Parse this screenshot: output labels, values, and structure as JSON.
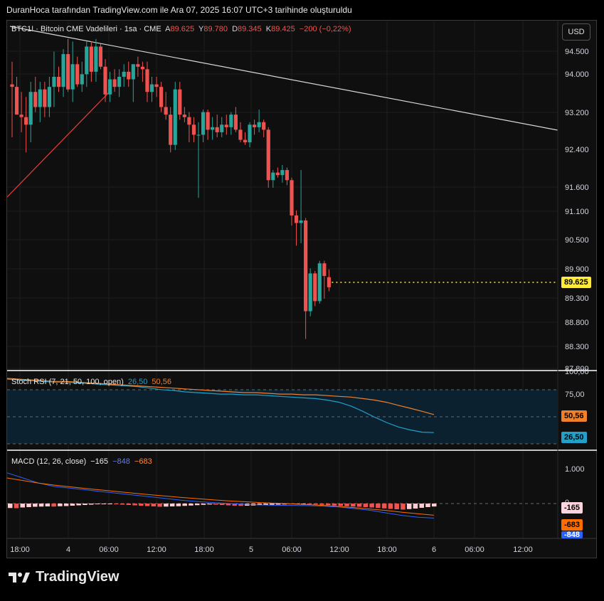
{
  "header": {
    "caption": "DuranHoca tarafından TradingView.com ile Ara 07, 2025 16:07 UTC+3 tarihinde oluşturuldu"
  },
  "currency_button": "USD",
  "legend": {
    "symbol": "BTC1! · Bitcoin CME Vadelileri · 1sa · CME",
    "o_label": "A",
    "o_value": "89.625",
    "h_label": "Y",
    "h_value": "89.780",
    "l_label": "D",
    "l_value": "89.345",
    "c_label": "K",
    "c_value": "89.425",
    "change": "−200 (−0,22%)"
  },
  "last_price_tag": "89.625",
  "stoch": {
    "title": "Stoch RSI (7, 21, 50, 100, open)",
    "k": "26,50",
    "d": "50,56",
    "tag_d": "50,56",
    "tag_k": "26,50"
  },
  "macd": {
    "title": "MACD (12, 26, close)",
    "hist": "−165",
    "macd": "−848",
    "signal": "−683",
    "tag_hist": "-165",
    "tag_signal": "-683",
    "tag_macd": "-848"
  },
  "brand": {
    "name": "TradingView"
  },
  "colors": {
    "up": "#26a69a",
    "down": "#ef5350",
    "stoch_k": "#22a0c8",
    "stoch_d": "#f0802a",
    "macd": "#2962ff",
    "signal": "#ff6d00",
    "last_price": "#ffeb3b"
  },
  "chart_data": [
    {
      "type": "candlestick",
      "title": "BTC1! · Bitcoin CME Vadelileri · 1sa · CME",
      "price_axis_ticks": [
        "94.500",
        "94.000",
        "93.200",
        "92.400",
        "91.600",
        "91.100",
        "90.500",
        "89.900",
        "89.300",
        "88.800",
        "88.300",
        "87.800"
      ],
      "time_axis_ticks": [
        "18:00",
        "4",
        "06:00",
        "12:00",
        "18:00",
        "5",
        "06:00",
        "12:00",
        "18:00",
        "6",
        "06:00",
        "12:00"
      ],
      "candles": [
        {
          "o": 93.45,
          "h": 93.9,
          "l": 92.4,
          "c": 93.4
        },
        {
          "o": 93.4,
          "h": 93.6,
          "l": 92.9,
          "c": 92.85
        },
        {
          "o": 92.85,
          "h": 93.3,
          "l": 92.5,
          "c": 92.8
        },
        {
          "o": 92.8,
          "h": 93.2,
          "l": 92.1,
          "c": 92.65
        },
        {
          "o": 92.65,
          "h": 93.5,
          "l": 92.3,
          "c": 93.3
        },
        {
          "o": 93.3,
          "h": 93.6,
          "l": 92.9,
          "c": 93.0
        },
        {
          "o": 93.0,
          "h": 93.5,
          "l": 92.7,
          "c": 93.35
        },
        {
          "o": 93.35,
          "h": 93.5,
          "l": 92.8,
          "c": 93.0
        },
        {
          "o": 93.0,
          "h": 93.6,
          "l": 92.8,
          "c": 93.4
        },
        {
          "o": 93.4,
          "h": 94.1,
          "l": 93.0,
          "c": 93.6
        },
        {
          "o": 93.6,
          "h": 93.8,
          "l": 93.3,
          "c": 93.4
        },
        {
          "o": 93.4,
          "h": 94.15,
          "l": 93.2,
          "c": 94.05
        },
        {
          "o": 94.05,
          "h": 94.35,
          "l": 93.3,
          "c": 93.35
        },
        {
          "o": 93.35,
          "h": 94.3,
          "l": 93.1,
          "c": 93.85
        },
        {
          "o": 93.85,
          "h": 94.0,
          "l": 93.4,
          "c": 93.45
        },
        {
          "o": 93.45,
          "h": 93.9,
          "l": 93.3,
          "c": 93.65
        },
        {
          "o": 93.65,
          "h": 94.3,
          "l": 93.4,
          "c": 94.2
        },
        {
          "o": 94.2,
          "h": 94.3,
          "l": 93.5,
          "c": 93.7
        },
        {
          "o": 93.7,
          "h": 94.35,
          "l": 93.5,
          "c": 94.2
        },
        {
          "o": 94.2,
          "h": 94.25,
          "l": 93.75,
          "c": 93.8
        },
        {
          "o": 93.8,
          "h": 93.95,
          "l": 93.1,
          "c": 93.25
        },
        {
          "o": 93.25,
          "h": 93.7,
          "l": 93.1,
          "c": 93.55
        },
        {
          "o": 93.55,
          "h": 93.75,
          "l": 93.3,
          "c": 93.4
        },
        {
          "o": 93.4,
          "h": 93.75,
          "l": 93.2,
          "c": 93.6
        },
        {
          "o": 93.6,
          "h": 93.85,
          "l": 93.4,
          "c": 93.7
        },
        {
          "o": 93.7,
          "h": 93.9,
          "l": 93.4,
          "c": 93.55
        },
        {
          "o": 93.55,
          "h": 93.8,
          "l": 93.1,
          "c": 93.85
        },
        {
          "o": 93.85,
          "h": 94.0,
          "l": 93.6,
          "c": 93.8
        },
        {
          "o": 93.8,
          "h": 93.9,
          "l": 93.5,
          "c": 93.75
        },
        {
          "o": 93.75,
          "h": 93.9,
          "l": 93.1,
          "c": 93.3
        },
        {
          "o": 93.3,
          "h": 93.6,
          "l": 93.1,
          "c": 93.45
        },
        {
          "o": 93.45,
          "h": 93.6,
          "l": 93.2,
          "c": 93.4
        },
        {
          "o": 93.4,
          "h": 93.5,
          "l": 92.9,
          "c": 93.0
        },
        {
          "o": 93.0,
          "h": 93.3,
          "l": 92.75,
          "c": 92.85
        },
        {
          "o": 92.85,
          "h": 93.0,
          "l": 92.1,
          "c": 92.25
        },
        {
          "o": 92.25,
          "h": 93.5,
          "l": 92.15,
          "c": 93.35
        },
        {
          "o": 93.35,
          "h": 93.5,
          "l": 92.75,
          "c": 92.85
        },
        {
          "o": 92.85,
          "h": 93.0,
          "l": 92.7,
          "c": 92.8
        },
        {
          "o": 92.8,
          "h": 92.9,
          "l": 92.3,
          "c": 92.65
        },
        {
          "o": 92.65,
          "h": 92.8,
          "l": 92.3,
          "c": 92.45
        },
        {
          "o": 92.45,
          "h": 92.7,
          "l": 91.2,
          "c": 92.45
        },
        {
          "o": 92.45,
          "h": 92.95,
          "l": 92.3,
          "c": 92.9
        },
        {
          "o": 92.9,
          "h": 92.95,
          "l": 92.35,
          "c": 92.55
        },
        {
          "o": 92.55,
          "h": 92.8,
          "l": 92.35,
          "c": 92.6
        },
        {
          "o": 92.6,
          "h": 92.85,
          "l": 92.4,
          "c": 92.5
        },
        {
          "o": 92.5,
          "h": 92.8,
          "l": 92.4,
          "c": 92.65
        },
        {
          "o": 92.65,
          "h": 92.85,
          "l": 92.45,
          "c": 92.6
        },
        {
          "o": 92.6,
          "h": 92.9,
          "l": 92.45,
          "c": 92.85
        },
        {
          "o": 92.85,
          "h": 93.0,
          "l": 92.5,
          "c": 92.55
        },
        {
          "o": 92.55,
          "h": 92.7,
          "l": 92.3,
          "c": 92.35
        },
        {
          "o": 92.35,
          "h": 92.5,
          "l": 92.25,
          "c": 92.3
        },
        {
          "o": 92.3,
          "h": 92.7,
          "l": 92.2,
          "c": 92.65
        },
        {
          "o": 92.65,
          "h": 92.75,
          "l": 92.45,
          "c": 92.6
        },
        {
          "o": 92.6,
          "h": 92.95,
          "l": 92.5,
          "c": 92.7
        },
        {
          "o": 92.7,
          "h": 92.75,
          "l": 92.4,
          "c": 92.55
        },
        {
          "o": 92.55,
          "h": 92.6,
          "l": 91.4,
          "c": 91.55
        },
        {
          "o": 91.55,
          "h": 91.75,
          "l": 91.4,
          "c": 91.7
        },
        {
          "o": 91.7,
          "h": 91.8,
          "l": 91.6,
          "c": 91.65
        },
        {
          "o": 91.65,
          "h": 91.85,
          "l": 91.5,
          "c": 91.75
        },
        {
          "o": 91.75,
          "h": 91.8,
          "l": 91.45,
          "c": 91.55
        },
        {
          "o": 91.55,
          "h": 91.6,
          "l": 90.65,
          "c": 90.85
        },
        {
          "o": 90.85,
          "h": 90.95,
          "l": 90.25,
          "c": 90.7
        },
        {
          "o": 90.7,
          "h": 91.75,
          "l": 90.3,
          "c": 90.75
        },
        {
          "o": 90.75,
          "h": 90.8,
          "l": 88.4,
          "c": 88.95
        },
        {
          "o": 88.95,
          "h": 89.8,
          "l": 88.85,
          "c": 89.7
        },
        {
          "o": 89.7,
          "h": 89.75,
          "l": 89.05,
          "c": 89.15
        },
        {
          "o": 89.15,
          "h": 89.95,
          "l": 89.1,
          "c": 89.9
        },
        {
          "o": 89.9,
          "h": 89.95,
          "l": 89.2,
          "c": 89.65
        },
        {
          "o": 89.625,
          "h": 89.78,
          "l": 89.345,
          "c": 89.425
        }
      ]
    },
    {
      "type": "line",
      "title": "Stoch RSI (7, 21, 50, 100, open)",
      "axis_ticks": [
        "100,00",
        "75,00"
      ],
      "series": [
        {
          "name": "K",
          "values": [
            98,
            97,
            96,
            95,
            94,
            94,
            93,
            92,
            91,
            90,
            89,
            88,
            86,
            84,
            83,
            81,
            80,
            79,
            78,
            78,
            77,
            77,
            76,
            75,
            74,
            73,
            72,
            70,
            67,
            62,
            55,
            47,
            40,
            34,
            30,
            27,
            26.5
          ]
        },
        {
          "name": "D",
          "values": [
            99,
            98,
            97,
            96,
            95,
            95,
            94,
            93,
            92,
            91,
            90,
            89,
            88,
            87,
            86,
            85,
            84,
            83,
            82,
            81,
            80,
            80,
            79,
            78,
            78,
            77,
            77,
            76,
            75,
            74,
            72,
            70,
            67,
            63,
            59,
            55,
            50.56
          ]
        }
      ]
    },
    {
      "type": "bar+line",
      "title": "MACD (12, 26, close)",
      "axis_ticks": [
        "1.000",
        "0"
      ],
      "histogram": [
        -250,
        -260,
        -220,
        -200,
        -180,
        -170,
        -160,
        -170,
        -150,
        -140,
        -120,
        -100,
        -80,
        -60,
        -40,
        -30,
        -20,
        -40,
        -60,
        -80,
        -100,
        -120,
        -140,
        -160,
        -180,
        -170,
        -160,
        -150,
        -130,
        -110,
        -90,
        -70,
        -50,
        -60,
        -80,
        -100,
        -120,
        -130,
        -120,
        -110,
        -90,
        -80,
        -70,
        -60,
        -50,
        -40,
        -30,
        -20,
        -30,
        -50,
        -70,
        -90,
        -110,
        -130,
        -150,
        -170,
        -180,
        -200,
        -220,
        -250,
        -270,
        -300,
        -320,
        -340,
        -310,
        -280,
        -240,
        -200,
        -165
      ],
      "series": [
        {
          "name": "MACD",
          "values": [
            1800,
            1500,
            1200,
            1000,
            900,
            800,
            700,
            600,
            500,
            400,
            300,
            200,
            120,
            60,
            10,
            -40,
            -80,
            -100,
            -110,
            -120,
            -150,
            -200,
            -300,
            -400,
            -550,
            -700,
            -800,
            -848
          ]
        },
        {
          "name": "Signal",
          "values": [
            1500,
            1350,
            1200,
            1080,
            980,
            880,
            790,
            700,
            610,
            520,
            440,
            360,
            290,
            220,
            160,
            110,
            60,
            20,
            -20,
            -60,
            -110,
            -170,
            -240,
            -320,
            -410,
            -510,
            -600,
            -683
          ]
        }
      ]
    }
  ]
}
